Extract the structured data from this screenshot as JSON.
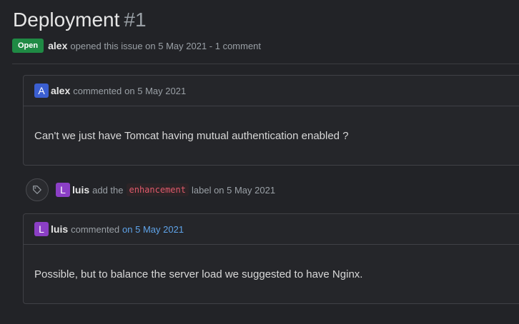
{
  "issue": {
    "title": "Deployment",
    "number": "#1",
    "status": "Open",
    "author": "alex",
    "meta_text": "opened this issue on 5 May 2021 - 1 comment"
  },
  "comments": [
    {
      "avatar_letter": "A",
      "author": "alex",
      "action": "commented",
      "date": "on 5 May 2021",
      "body": "Can't we just have Tomcat having mutual authentication enabled ?"
    },
    {
      "avatar_letter": "L",
      "author": "luis",
      "action": "commented",
      "date": "on 5 May 2021",
      "body": "Possible, but to balance the server load we suggested to have Nginx."
    }
  ],
  "event": {
    "icon": "tag-icon",
    "avatar_letter": "L",
    "author": "luis",
    "action": "add the",
    "label": "enhancement",
    "suffix": "label on 5 May 2021"
  },
  "colors": {
    "background": "#222327",
    "open_badge": "#1f8a44",
    "link": "#5fa3e8",
    "label_text": "#e05a6b",
    "avatar_alex": "#3b5fd1",
    "avatar_luis": "#8b3fc5"
  }
}
